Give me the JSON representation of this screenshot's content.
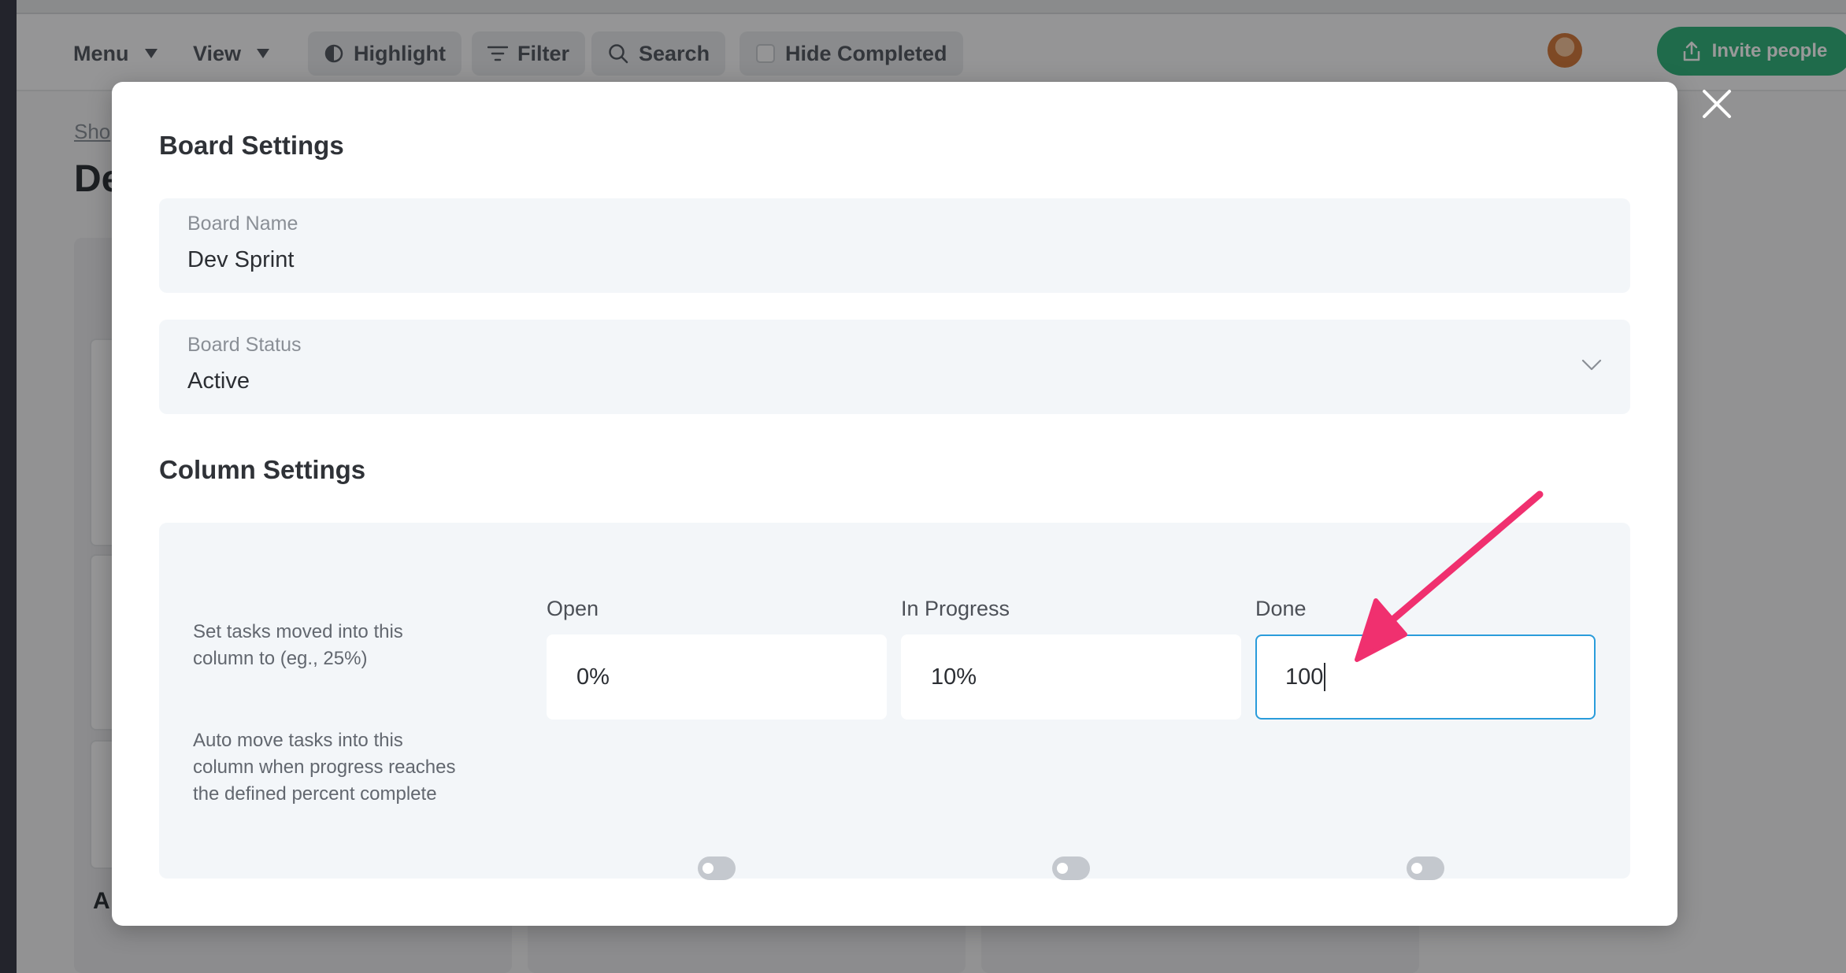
{
  "toolbar": {
    "menu_label": "Menu",
    "view_label": "View",
    "highlight_label": "Highlight",
    "filter_label": "Filter",
    "search_label": "Search",
    "hide_completed_label": "Hide Completed",
    "invite_label": "Invite people"
  },
  "background": {
    "link_text": "Sho",
    "title_text": "De",
    "add_text": "A"
  },
  "modal": {
    "title": "Board Settings",
    "board_name": {
      "label": "Board Name",
      "value": "Dev Sprint"
    },
    "board_status": {
      "label": "Board Status",
      "value": "Active"
    },
    "column_settings_title": "Column Settings",
    "percent_label": "Set tasks moved into this column to (eg., 25%)",
    "auto_move_label": "Auto move tasks into this column when progress reaches the defined percent complete",
    "columns": [
      {
        "name": "Open",
        "value": "0%",
        "auto_move": false
      },
      {
        "name": "In Progress",
        "value": "10%",
        "auto_move": false
      },
      {
        "name": "Done",
        "value": "100",
        "auto_move": false
      }
    ]
  },
  "colors": {
    "accent_focus": "#2a9cdb",
    "annotation_arrow": "#f0306f",
    "invite_green": "#34b27d"
  }
}
